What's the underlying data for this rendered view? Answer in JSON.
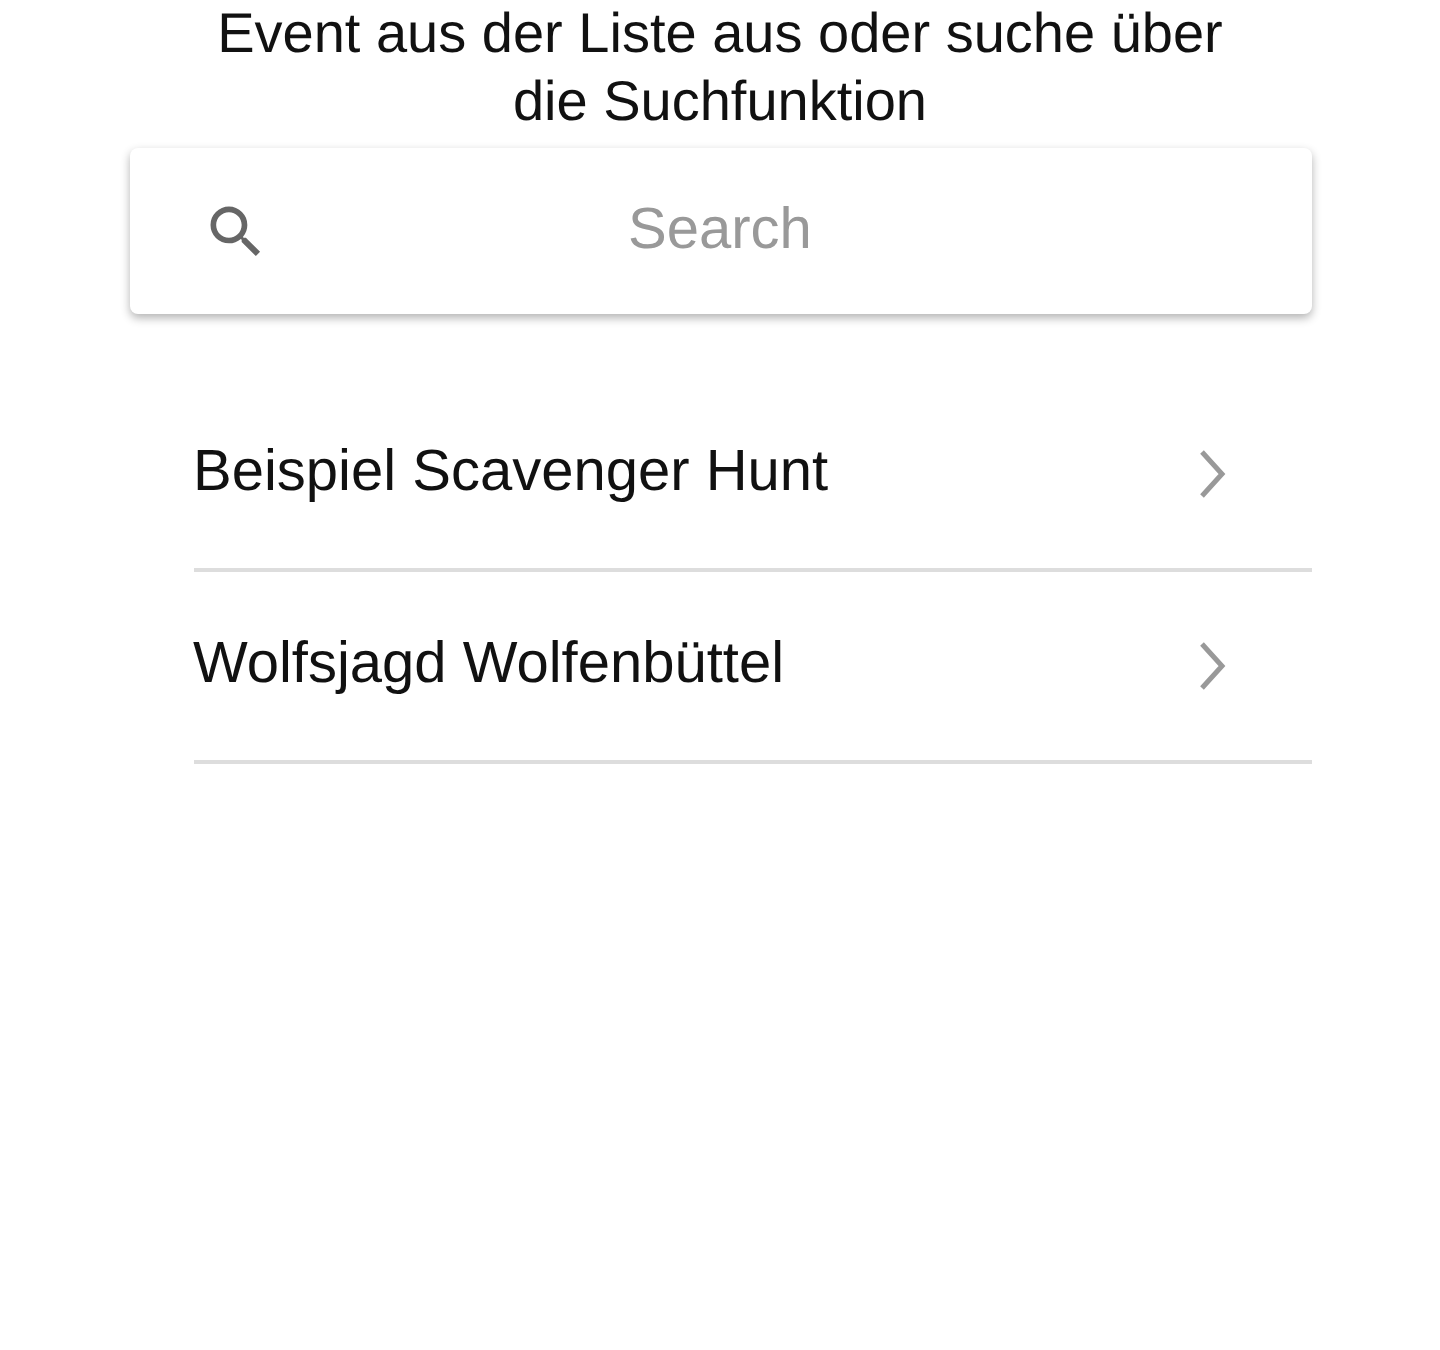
{
  "instructions": [
    "Event aus der Liste aus oder suche über",
    "die Suchfunktion"
  ],
  "search": {
    "placeholder": "Search"
  },
  "events": [
    {
      "name": "Beispiel Scavenger Hunt"
    },
    {
      "name": "Wolfsjagd Wolfenbüttel"
    }
  ]
}
